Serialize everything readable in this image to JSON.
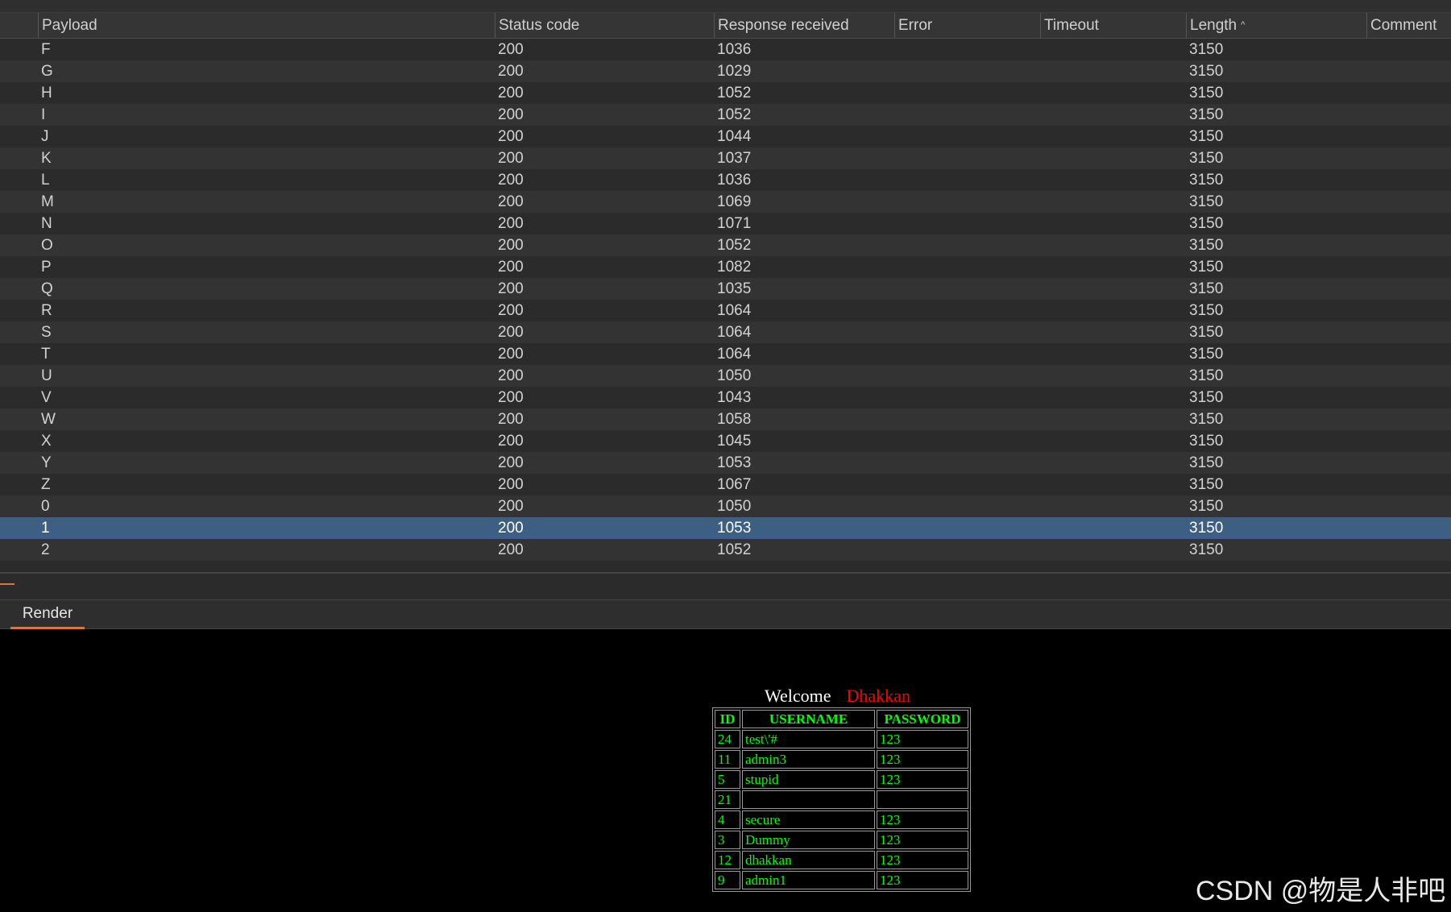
{
  "results_table": {
    "columns": {
      "payload": "Payload",
      "status_code": "Status code",
      "response_received": "Response received",
      "error": "Error",
      "timeout": "Timeout",
      "length": "Length",
      "comment": "Comment"
    },
    "sort_column": "length",
    "rows": [
      {
        "payload": "F",
        "status": "200",
        "response": "1036",
        "error": "",
        "timeout": "",
        "length": "3150",
        "comment": ""
      },
      {
        "payload": "G",
        "status": "200",
        "response": "1029",
        "error": "",
        "timeout": "",
        "length": "3150",
        "comment": ""
      },
      {
        "payload": "H",
        "status": "200",
        "response": "1052",
        "error": "",
        "timeout": "",
        "length": "3150",
        "comment": ""
      },
      {
        "payload": "I",
        "status": "200",
        "response": "1052",
        "error": "",
        "timeout": "",
        "length": "3150",
        "comment": ""
      },
      {
        "payload": "J",
        "status": "200",
        "response": "1044",
        "error": "",
        "timeout": "",
        "length": "3150",
        "comment": ""
      },
      {
        "payload": "K",
        "status": "200",
        "response": "1037",
        "error": "",
        "timeout": "",
        "length": "3150",
        "comment": ""
      },
      {
        "payload": "L",
        "status": "200",
        "response": "1036",
        "error": "",
        "timeout": "",
        "length": "3150",
        "comment": ""
      },
      {
        "payload": "M",
        "status": "200",
        "response": "1069",
        "error": "",
        "timeout": "",
        "length": "3150",
        "comment": ""
      },
      {
        "payload": "N",
        "status": "200",
        "response": "1071",
        "error": "",
        "timeout": "",
        "length": "3150",
        "comment": ""
      },
      {
        "payload": "O",
        "status": "200",
        "response": "1052",
        "error": "",
        "timeout": "",
        "length": "3150",
        "comment": ""
      },
      {
        "payload": "P",
        "status": "200",
        "response": "1082",
        "error": "",
        "timeout": "",
        "length": "3150",
        "comment": ""
      },
      {
        "payload": "Q",
        "status": "200",
        "response": "1035",
        "error": "",
        "timeout": "",
        "length": "3150",
        "comment": ""
      },
      {
        "payload": "R",
        "status": "200",
        "response": "1064",
        "error": "",
        "timeout": "",
        "length": "3150",
        "comment": ""
      },
      {
        "payload": "S",
        "status": "200",
        "response": "1064",
        "error": "",
        "timeout": "",
        "length": "3150",
        "comment": ""
      },
      {
        "payload": "T",
        "status": "200",
        "response": "1064",
        "error": "",
        "timeout": "",
        "length": "3150",
        "comment": ""
      },
      {
        "payload": "U",
        "status": "200",
        "response": "1050",
        "error": "",
        "timeout": "",
        "length": "3150",
        "comment": ""
      },
      {
        "payload": "V",
        "status": "200",
        "response": "1043",
        "error": "",
        "timeout": "",
        "length": "3150",
        "comment": ""
      },
      {
        "payload": "W",
        "status": "200",
        "response": "1058",
        "error": "",
        "timeout": "",
        "length": "3150",
        "comment": ""
      },
      {
        "payload": "X",
        "status": "200",
        "response": "1045",
        "error": "",
        "timeout": "",
        "length": "3150",
        "comment": ""
      },
      {
        "payload": "Y",
        "status": "200",
        "response": "1053",
        "error": "",
        "timeout": "",
        "length": "3150",
        "comment": ""
      },
      {
        "payload": "Z",
        "status": "200",
        "response": "1067",
        "error": "",
        "timeout": "",
        "length": "3150",
        "comment": ""
      },
      {
        "payload": "0",
        "status": "200",
        "response": "1050",
        "error": "",
        "timeout": "",
        "length": "3150",
        "comment": ""
      },
      {
        "payload": "1",
        "status": "200",
        "response": "1053",
        "error": "",
        "timeout": "",
        "length": "3150",
        "comment": "",
        "selected": true
      },
      {
        "payload": "2",
        "status": "200",
        "response": "1052",
        "error": "",
        "timeout": "",
        "length": "3150",
        "comment": ""
      }
    ]
  },
  "viewer_tabs": {
    "render_label": "Render"
  },
  "render_page": {
    "welcome_text": "Welcome",
    "welcome_name": "Dhakkan",
    "table_headers": {
      "id": "ID",
      "username": "USERNAME",
      "password": "PASSWORD"
    },
    "users": [
      {
        "id": "24",
        "username": "test\\'#",
        "password": "123"
      },
      {
        "id": "11",
        "username": "admin3",
        "password": "123"
      },
      {
        "id": "5",
        "username": "stupid",
        "password": "123"
      },
      {
        "id": "21",
        "username": "",
        "password": ""
      },
      {
        "id": "4",
        "username": "secure",
        "password": "123"
      },
      {
        "id": "3",
        "username": "Dummy",
        "password": "123"
      },
      {
        "id": "12",
        "username": "dhakkan",
        "password": "123"
      },
      {
        "id": "9",
        "username": "admin1",
        "password": "123"
      }
    ]
  },
  "watermark": "CSDN @物是人非吧",
  "colors": {
    "selected_row": "#3e5f84",
    "accent_orange": "#d9773a",
    "render_text_green": "#00ff00",
    "render_name_red": "#ff0000"
  }
}
